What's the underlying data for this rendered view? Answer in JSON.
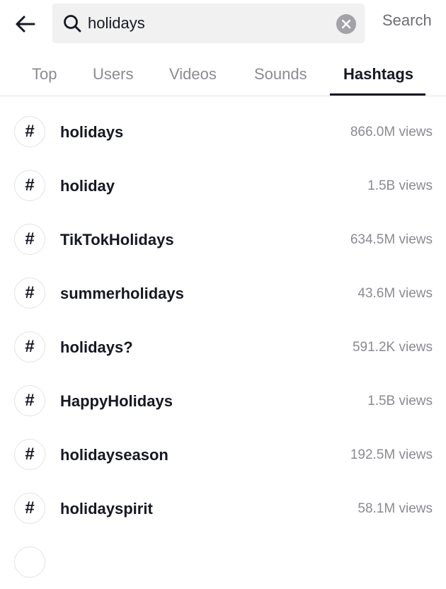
{
  "search": {
    "query": "holidays",
    "submit_label": "Search"
  },
  "tabs": [
    {
      "label": "Top"
    },
    {
      "label": "Users"
    },
    {
      "label": "Videos"
    },
    {
      "label": "Sounds"
    },
    {
      "label": "Hashtags",
      "active": true
    }
  ],
  "hashtags": {
    "symbol": "#",
    "items": [
      {
        "name": "holidays",
        "views": "866.0M views"
      },
      {
        "name": "holiday",
        "views": "1.5B views"
      },
      {
        "name": "TikTokHolidays",
        "views": "634.5M views"
      },
      {
        "name": "summerholidays",
        "views": "43.6M views"
      },
      {
        "name": "holidays?",
        "views": "591.2K views"
      },
      {
        "name": "HappyHolidays",
        "views": "1.5B views"
      },
      {
        "name": "holidayseason",
        "views": "192.5M views"
      },
      {
        "name": "holidayspirit",
        "views": "58.1M views"
      }
    ]
  },
  "colors": {
    "text_primary": "#161823",
    "text_secondary": "#8a8b91",
    "search_bg": "#f1f1f2",
    "divider": "#e3e3e4"
  }
}
